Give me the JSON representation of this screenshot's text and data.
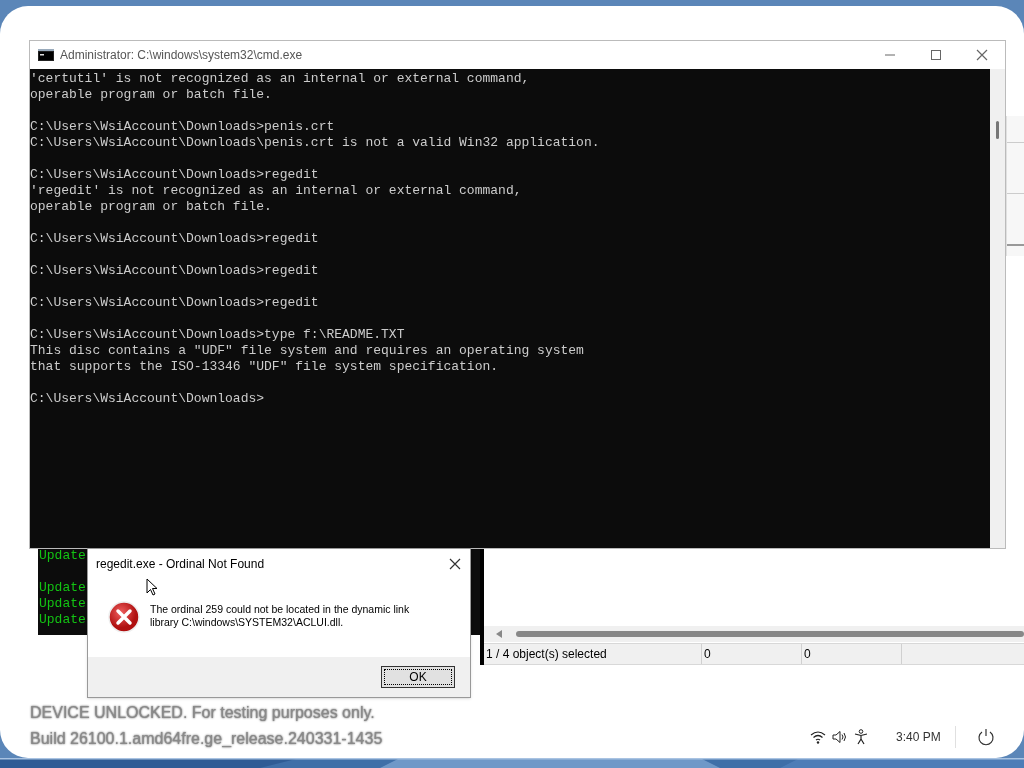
{
  "cmd_window": {
    "title": "Administrator: C:\\windows\\system32\\cmd.exe",
    "blocks": [
      [
        "'certutil' is not recognized as an internal or external command,",
        "operable program or batch file."
      ],
      [
        "C:\\Users\\WsiAccount\\Downloads>penis.crt",
        "C:\\Users\\WsiAccount\\Downloads\\penis.crt is not a valid Win32 application."
      ],
      [
        "C:\\Users\\WsiAccount\\Downloads>regedit",
        "'regedit' is not recognized as an internal or external command,",
        "operable program or batch file."
      ],
      [
        "C:\\Users\\WsiAccount\\Downloads>regedit"
      ],
      [
        "C:\\Users\\WsiAccount\\Downloads>regedit"
      ],
      [
        "C:\\Users\\WsiAccount\\Downloads>regedit"
      ],
      [
        "C:\\Users\\WsiAccount\\Downloads>type f:\\README.TXT",
        "This disc contains a \"UDF\" file system and requires an operating system",
        "that supports the ISO-13346 \"UDF\" file system specification."
      ],
      [
        "C:\\Users\\WsiAccount\\Downloads>"
      ]
    ]
  },
  "background_console": {
    "blocks": [
      [
        "Update"
      ],
      [
        "Update",
        "Update",
        "Update"
      ]
    ]
  },
  "explorer_status_bar": [
    "1 / 4 object(s) selected",
    "0",
    "0"
  ],
  "dialog": {
    "title": "regedit.exe - Ordinal Not Found",
    "message": "The ordinal 259 could not be located in the dynamic link library C:\\windows\\SYSTEM32\\ACLUI.dll.",
    "button": "OK"
  },
  "desktop_notice": [
    "DEVICE UNLOCKED. For testing purposes only.",
    "Build 26100.1.amd64fre.ge_release.240331-1435"
  ],
  "tray": {
    "time": "3:40 PM"
  }
}
